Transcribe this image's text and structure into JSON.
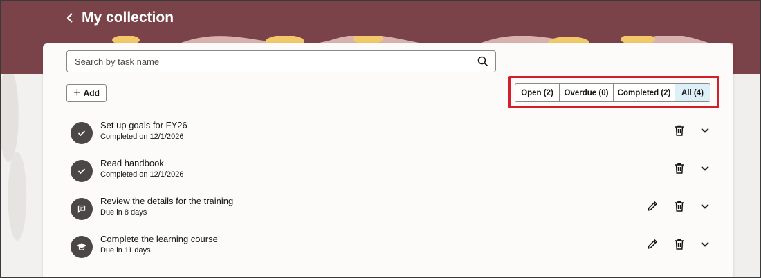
{
  "header": {
    "title": "My collection",
    "back_icon": "chevron-left-icon",
    "background_color": "#7a4349"
  },
  "search": {
    "placeholder": "Search by task name",
    "value": "",
    "icon": "search-icon"
  },
  "toolbar": {
    "add_label": "Add",
    "add_icon": "plus-icon"
  },
  "filters": [
    {
      "label": "Open (2)",
      "selected": false
    },
    {
      "label": "Overdue (0)",
      "selected": false
    },
    {
      "label": "Completed (2)",
      "selected": false
    },
    {
      "label": "All (4)",
      "selected": true
    }
  ],
  "highlight_color": "#d21f2b",
  "tasks": [
    {
      "title": "Set up goals for FY26",
      "status": "Completed on 12/1/2026",
      "icon": "check-icon",
      "editable": false
    },
    {
      "title": "Read handbook",
      "status": "Completed on 12/1/2026",
      "icon": "check-icon",
      "editable": false
    },
    {
      "title": "Review the details for the training",
      "status": "Due in 8 days",
      "icon": "chat-icon",
      "editable": true
    },
    {
      "title": "Complete the learning course",
      "status": "Due in 11 days",
      "icon": "graduation-cap-icon",
      "editable": true
    }
  ]
}
